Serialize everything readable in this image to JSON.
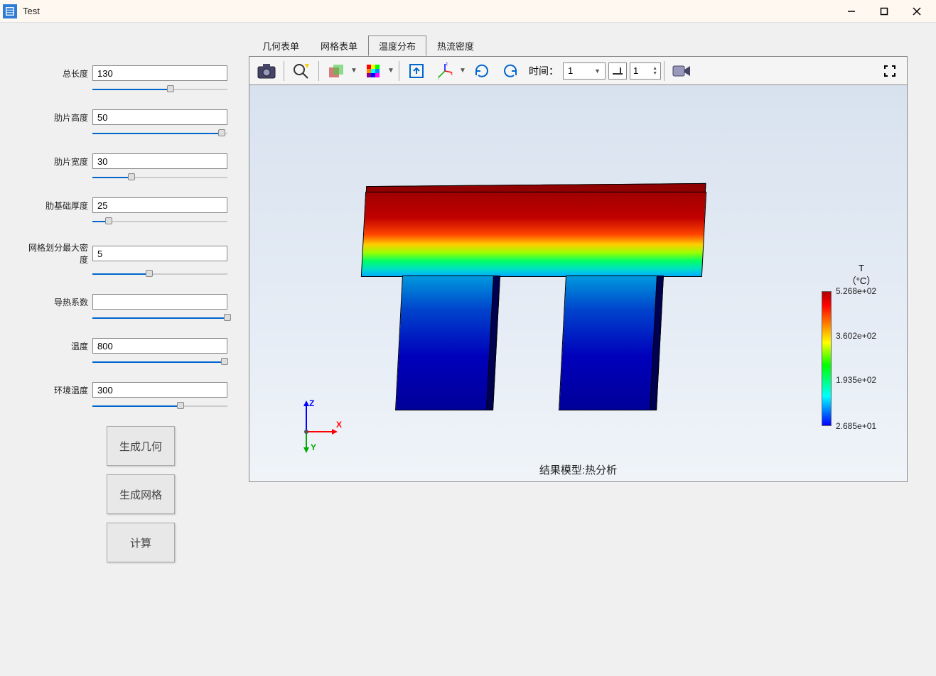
{
  "window": {
    "title": "Test"
  },
  "params": {
    "total_length": {
      "label": "总长度",
      "value": "130",
      "pct": 58
    },
    "fin_height": {
      "label": "肋片高度",
      "value": "50",
      "pct": 96
    },
    "fin_width": {
      "label": "肋片宽度",
      "value": "30",
      "pct": 29
    },
    "base_thick": {
      "label": "肋基础厚度",
      "value": "25",
      "pct": 12
    },
    "mesh_density": {
      "label": "网格划分最大密度",
      "value": "5",
      "pct": 42
    },
    "k": {
      "label": "导热系数",
      "value": "",
      "pct": 100
    },
    "temp": {
      "label": "温度",
      "value": "800",
      "pct": 98
    },
    "env_temp": {
      "label": "环境温度",
      "value": "300",
      "pct": 65
    }
  },
  "buttons": {
    "gen_geom": "生成几何",
    "gen_mesh": "生成网格",
    "calc": "计算"
  },
  "tabs": {
    "geom": "几何表单",
    "mesh": "网格表单",
    "temp_dist": "温度分布",
    "heat_flux": "热流密度"
  },
  "toolbar": {
    "time_label": "时间：",
    "time_value": "1",
    "step_value": "1"
  },
  "legend": {
    "title_var": "T",
    "title_unit": "（°C）",
    "v4": "5.268e+02",
    "v3": "3.602e+02",
    "v2": "1.935e+02",
    "v1": "2.685e+01"
  },
  "caption": "结果模型:热分析",
  "chart_data": {
    "type": "heatmap",
    "title": "结果模型:热分析",
    "variable": "T",
    "unit": "°C",
    "range": [
      26.85,
      526.8
    ],
    "ticks": [
      26.85,
      193.5,
      360.2,
      526.8
    ],
    "tick_labels": [
      "2.685e+01",
      "1.935e+02",
      "3.602e+02",
      "5.268e+02"
    ],
    "colormap": "rainbow",
    "description": "3D thermal analysis of finned heat sink; top plate is hottest (red) graduating through yellow/green to cyan; two downward legs are coldest (blue).",
    "time_step": 1
  }
}
